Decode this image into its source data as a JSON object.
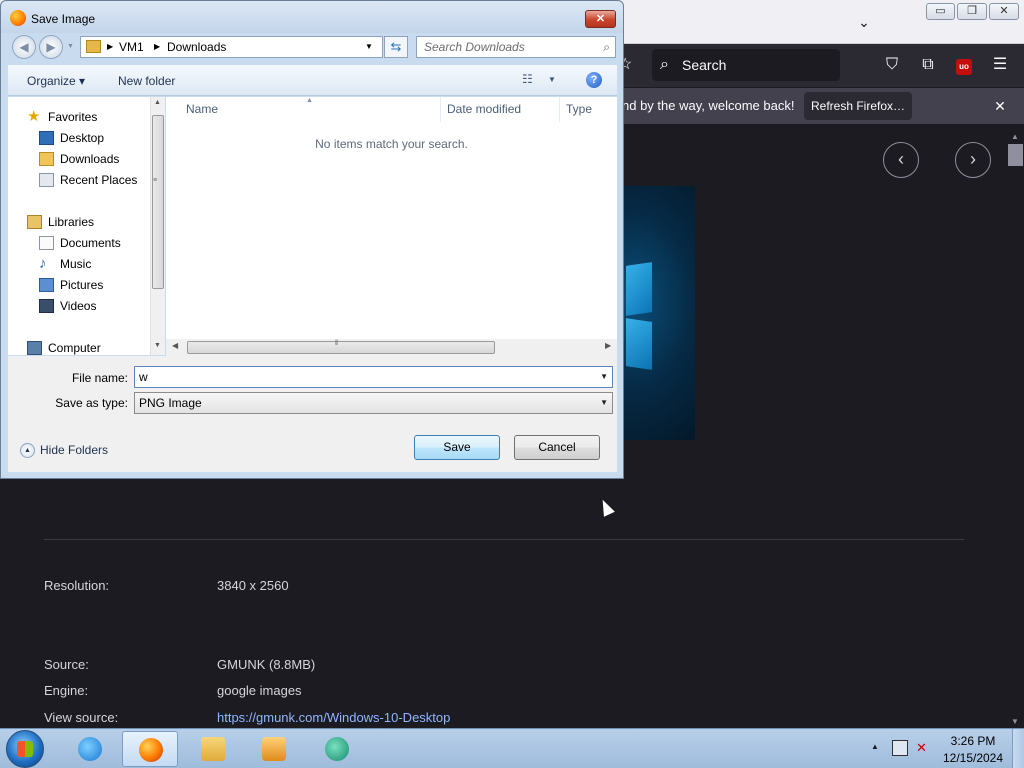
{
  "browser": {
    "notification_text": "nd by the way, welcome back!",
    "refresh_button": "Refresh Firefox…",
    "search_placeholder": "Search",
    "icons": {
      "chevron": "chevron-down-icon",
      "star": "bookmark-star-icon",
      "pocket": "pocket-icon",
      "extensions": "puzzle-icon",
      "ublock": "ublock-origin-icon",
      "menu": "hamburger-icon"
    },
    "ublock_badge": "uo",
    "window_controls": {
      "minimize": "▭",
      "maximize": "❐",
      "close": "✕"
    }
  },
  "image_details": {
    "resolution": {
      "label": "Resolution:",
      "value": "3840 x 2560"
    },
    "source": {
      "label": "Source:",
      "value": "GMUNK (8.8MB)"
    },
    "engine": {
      "label": "Engine:",
      "value": "google images"
    },
    "view_source": {
      "label": "View source:",
      "value": "https://gmunk.com/Windows-10-Desktop"
    }
  },
  "dialog": {
    "title": "Save Image",
    "address": {
      "segment1": "VM1",
      "segment2": "Downloads"
    },
    "search_placeholder": "Search Downloads",
    "toolbar": {
      "organize": "Organize ▾",
      "new_folder": "New folder",
      "help": "?"
    },
    "nav": {
      "favorites": "Favorites",
      "desktop": "Desktop",
      "downloads": "Downloads",
      "recent_places": "Recent Places",
      "libraries": "Libraries",
      "documents": "Documents",
      "music": "Music",
      "pictures": "Pictures",
      "videos": "Videos",
      "computer": "Computer"
    },
    "columns": {
      "name": "Name",
      "date_modified": "Date modified",
      "type": "Type"
    },
    "empty_message": "No items match your search.",
    "file_name_label": "File name:",
    "file_name_value": "w",
    "save_type_label": "Save as type:",
    "save_type_value": "PNG Image",
    "hide_folders": "Hide Folders",
    "save_button": "Save",
    "cancel_button": "Cancel"
  },
  "taskbar": {
    "apps": [
      "Internet Explorer",
      "Firefox",
      "Windows Explorer",
      "Media Player",
      "App"
    ],
    "time": "3:26 PM",
    "date": "12/15/2024"
  }
}
